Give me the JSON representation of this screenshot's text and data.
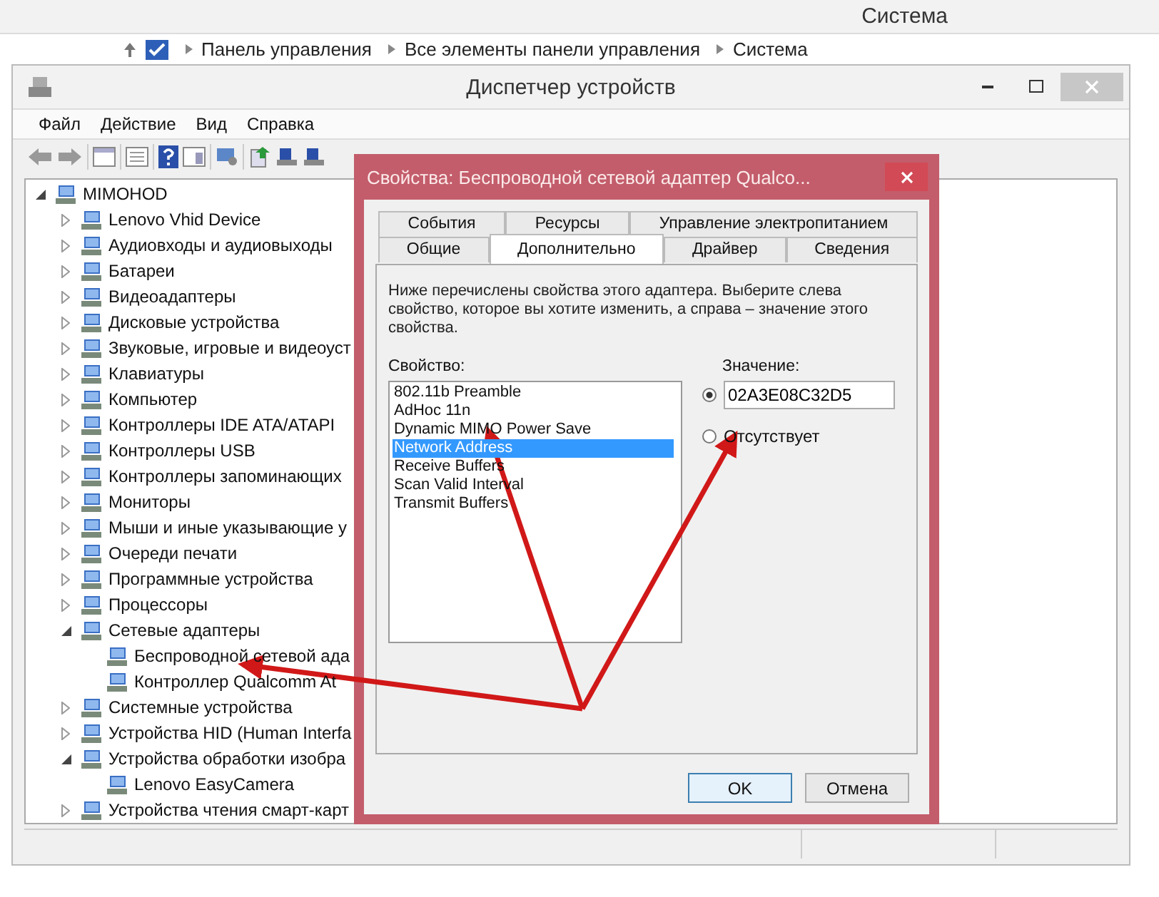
{
  "background_window": {
    "title": "Система",
    "breadcrumb": [
      "Панель управления",
      "Все элементы панели управления",
      "Система"
    ]
  },
  "window": {
    "title": "Диспетчер устройств"
  },
  "menu": [
    "Файл",
    "Действие",
    "Вид",
    "Справка"
  ],
  "tree": {
    "label": "MIMOHOD",
    "expanded": true,
    "children": [
      {
        "label": "Lenovo Vhid Device",
        "expanded": false
      },
      {
        "label": "Аудиовходы и аудиовыходы",
        "expanded": false
      },
      {
        "label": "Батареи",
        "expanded": false
      },
      {
        "label": "Видеоадаптеры",
        "expanded": false
      },
      {
        "label": "Дисковые устройства",
        "expanded": false
      },
      {
        "label": "Звуковые, игровые и видеоуст",
        "expanded": false
      },
      {
        "label": "Клавиатуры",
        "expanded": false
      },
      {
        "label": "Компьютер",
        "expanded": false
      },
      {
        "label": "Контроллеры IDE ATA/ATAPI",
        "expanded": false
      },
      {
        "label": "Контроллеры USB",
        "expanded": false
      },
      {
        "label": "Контроллеры запоминающих",
        "expanded": false
      },
      {
        "label": "Мониторы",
        "expanded": false
      },
      {
        "label": "Мыши и иные указывающие у",
        "expanded": false
      },
      {
        "label": "Очереди печати",
        "expanded": false
      },
      {
        "label": "Программные устройства",
        "expanded": false
      },
      {
        "label": "Процессоры",
        "expanded": false
      },
      {
        "label": "Сетевые адаптеры",
        "expanded": true,
        "children": [
          {
            "label": "Беспроводной сетевой ада"
          },
          {
            "label": "Контроллер Qualcomm At"
          }
        ]
      },
      {
        "label": "Системные устройства",
        "expanded": false
      },
      {
        "label": "Устройства HID (Human Interfa",
        "expanded": false
      },
      {
        "label": "Устройства обработки изобра",
        "expanded": true,
        "children": [
          {
            "label": "Lenovo EasyCamera"
          }
        ]
      },
      {
        "label": "Устройства чтения смарт-карт",
        "expanded": false
      }
    ]
  },
  "dialog": {
    "title": "Свойства: Беспроводной сетевой адаптер Qualco...",
    "tab_rows": [
      [
        {
          "label": "События",
          "selected": false
        },
        {
          "label": "Ресурсы",
          "selected": false
        },
        {
          "label": "Управление электропитанием",
          "selected": false
        }
      ],
      [
        {
          "label": "Общие",
          "selected": false
        },
        {
          "label": "Дополнительно",
          "selected": true
        },
        {
          "label": "Драйвер",
          "selected": false
        },
        {
          "label": "Сведения",
          "selected": false
        }
      ]
    ],
    "description": "Ниже перечислены свойства этого адаптера. Выберите слева свойство, которое вы хотите изменить, а справа – значение этого свойства.",
    "property_label": "Свойство:",
    "properties": [
      {
        "label": "802.11b Preamble",
        "selected": false
      },
      {
        "label": "AdHoc 11n",
        "selected": false
      },
      {
        "label": "Dynamic MIMO Power Save",
        "selected": false
      },
      {
        "label": "Network Address",
        "selected": true
      },
      {
        "label": "Receive Buffers",
        "selected": false
      },
      {
        "label": "Scan Valid Interval",
        "selected": false
      },
      {
        "label": "Transmit Buffers",
        "selected": false
      }
    ],
    "value_label": "Значение:",
    "value_field": {
      "value": "02A3E08C32D5",
      "selected": true
    },
    "absent_option": {
      "label": "Отсутствует",
      "selected": false
    },
    "buttons": [
      "OK",
      "Отмена"
    ]
  }
}
